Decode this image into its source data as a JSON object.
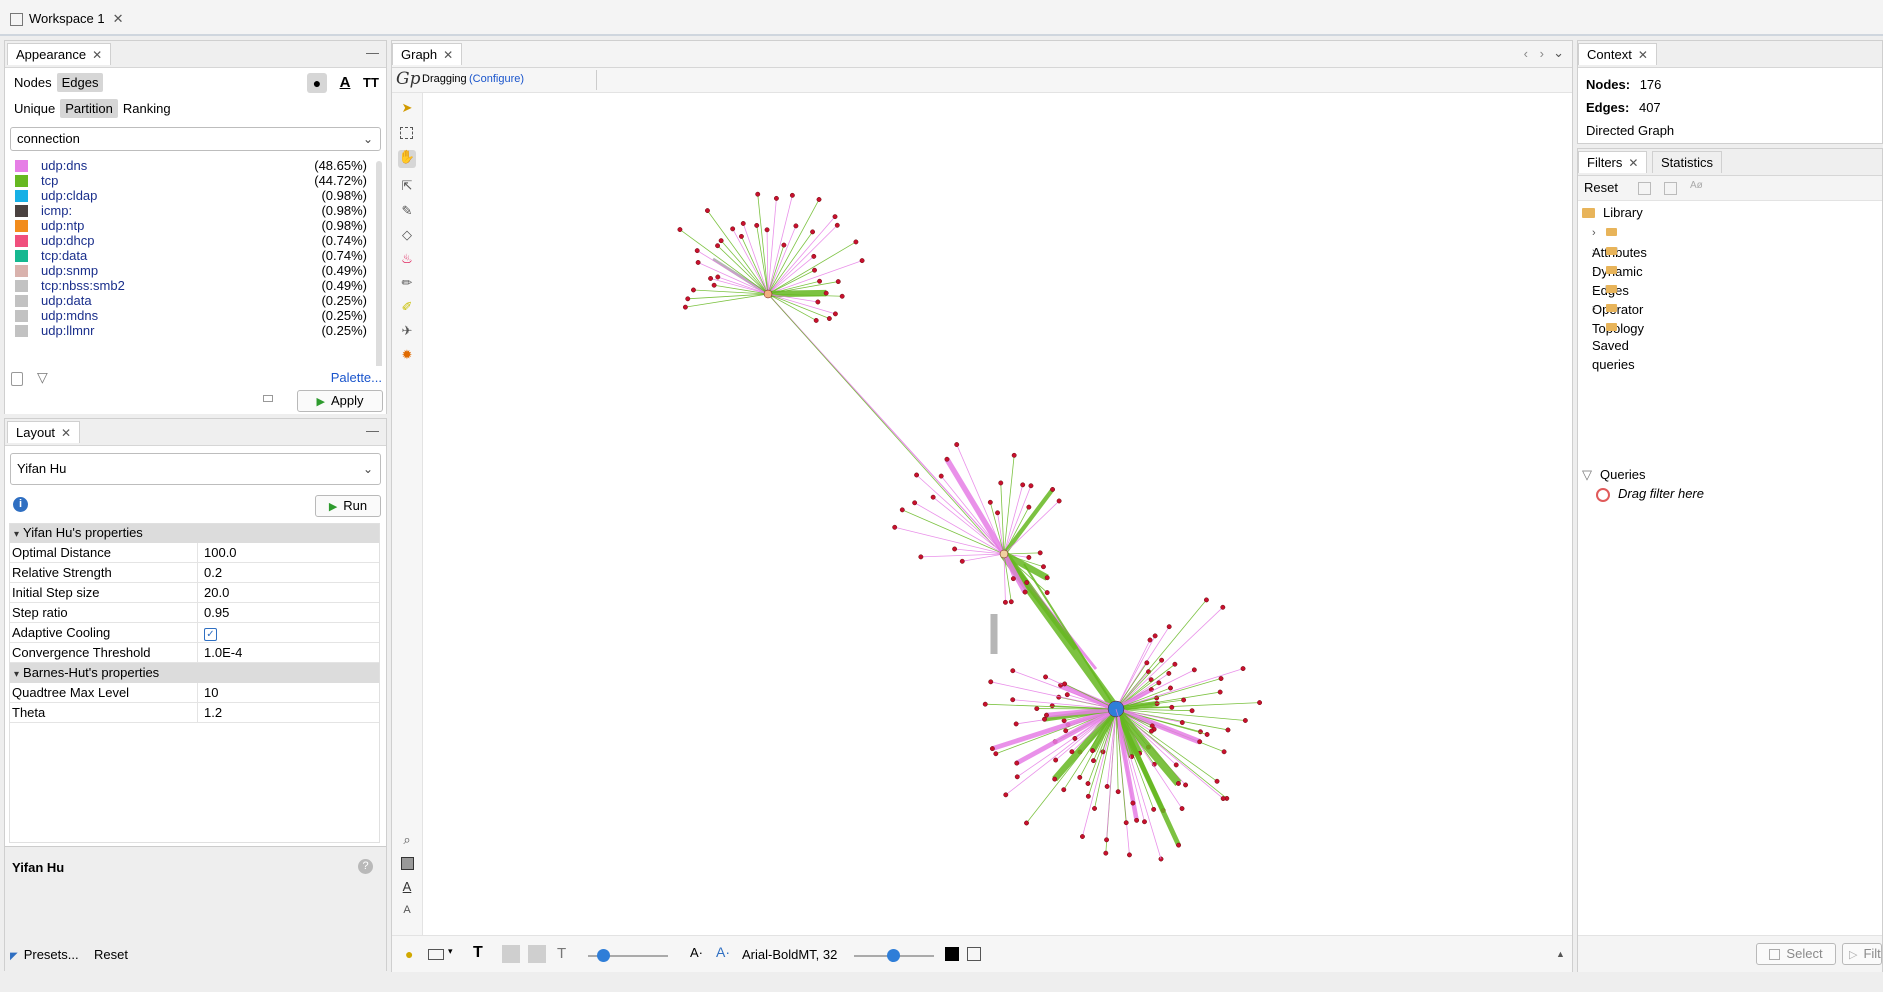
{
  "workspace_tab": "Workspace 1",
  "appearance": {
    "title": "Appearance",
    "element_tabs": [
      "Nodes",
      "Edges"
    ],
    "selected_element_tab": "Edges",
    "mode_tabs": [
      "Unique",
      "Partition",
      "Ranking"
    ],
    "selected_mode_tab": "Partition",
    "attribute": "connection",
    "partitions": [
      {
        "name": "udp:dns",
        "percent": "(48.65%)",
        "color": "#e67ee6"
      },
      {
        "name": "tcp",
        "percent": "(44.72%)",
        "color": "#66b821"
      },
      {
        "name": "udp:cldap",
        "percent": "(0.98%)",
        "color": "#16b0e6"
      },
      {
        "name": "icmp:",
        "percent": "(0.98%)",
        "color": "#4a4240"
      },
      {
        "name": "udp:ntp",
        "percent": "(0.98%)",
        "color": "#f28c1c"
      },
      {
        "name": "udp:dhcp",
        "percent": "(0.74%)",
        "color": "#f04f7d"
      },
      {
        "name": "tcp:data",
        "percent": "(0.74%)",
        "color": "#15b890"
      },
      {
        "name": "udp:snmp",
        "percent": "(0.49%)",
        "color": "#d9b2ad"
      },
      {
        "name": "tcp:nbss:smb2",
        "percent": "(0.49%)",
        "color": "#c2c2c2"
      },
      {
        "name": "udp:data",
        "percent": "(0.25%)",
        "color": "#c2c2c2"
      },
      {
        "name": "udp:mdns",
        "percent": "(0.25%)",
        "color": "#c2c2c2"
      },
      {
        "name": "udp:llmnr",
        "percent": "(0.25%)",
        "color": "#c2c2c2"
      }
    ],
    "palette_link": "Palette...",
    "apply_button": "Apply"
  },
  "layout": {
    "title": "Layout",
    "algorithm": "Yifan Hu",
    "run_button": "Run",
    "sections": [
      {
        "title": "Yifan Hu's properties",
        "rows": [
          {
            "key": "Optimal Distance",
            "value": "100.0"
          },
          {
            "key": "Relative Strength",
            "value": "0.2"
          },
          {
            "key": "Initial Step size",
            "value": "20.0"
          },
          {
            "key": "Step ratio",
            "value": "0.95"
          },
          {
            "key": "Adaptive Cooling",
            "value": "",
            "checked": true
          },
          {
            "key": "Convergence Threshold",
            "value": "1.0E-4"
          }
        ]
      },
      {
        "title": "Barnes-Hut's properties",
        "rows": [
          {
            "key": "Quadtree Max Level",
            "value": "10"
          },
          {
            "key": "Theta",
            "value": "1.2"
          }
        ]
      }
    ],
    "description_title": "Yifan Hu",
    "presets_label": "Presets...",
    "reset_label": "Reset"
  },
  "graph": {
    "tab": "Graph",
    "mode_label": "Dragging",
    "configure_link": "(Configure)",
    "font_label": "Arial-BoldMT, 32",
    "colors": {
      "dns": "#e67ee6",
      "tcp": "#66b821",
      "node": "#c8102e",
      "hub": "#2f7ed8"
    }
  },
  "context": {
    "title": "Context",
    "nodes_label": "Nodes:",
    "nodes_value": "176",
    "edges_label": "Edges:",
    "edges_value": "407",
    "graph_type": "Directed Graph"
  },
  "filters": {
    "tabs": [
      "Filters",
      "Statistics"
    ],
    "reset_button": "Reset",
    "library_label": "Library",
    "categories": [
      "Attributes",
      "Dynamic",
      "Edges",
      "Operator",
      "Topology"
    ],
    "saved_queries": "Saved queries",
    "queries_label": "Queries",
    "drag_hint": "Drag filter here",
    "select_button": "Select",
    "filter_button": "Filter"
  }
}
